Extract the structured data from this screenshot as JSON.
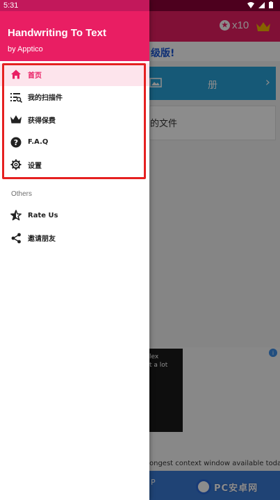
{
  "status_bar": {
    "time": "5:31"
  },
  "drawer": {
    "app_title": "Handwriting To Text",
    "app_subtitle": "by Apptico",
    "menu": [
      {
        "label": "首页",
        "icon": "home-icon",
        "active": true
      },
      {
        "label": "我的扫描件",
        "icon": "scan-list-icon",
        "active": false
      },
      {
        "label": "获得保费",
        "icon": "crown-icon",
        "active": false
      },
      {
        "label": "F.A.Q",
        "icon": "help-circle-icon",
        "active": false
      },
      {
        "label": "设置",
        "icon": "gear-icon",
        "active": false
      }
    ],
    "section_others": "Others",
    "others": [
      {
        "label": "Rate Us",
        "icon": "star-half-icon"
      },
      {
        "label": "邀请朋友",
        "icon": "share-icon"
      }
    ]
  },
  "background": {
    "coins": "x10",
    "upgrade_text": "级版!",
    "banner_text": "册",
    "files_text": "的文件",
    "ad_text_1": "lex",
    "ad_text_2": "t a lot",
    "ad_caption": "ongest context window available today.",
    "bottom_bar_text": "P",
    "watermark_text": "PC安卓网"
  },
  "colors": {
    "primary": "#e91e63",
    "primary_dark": "#c2185b",
    "active_bg": "#fde4ec",
    "highlight_box": "#e52020"
  }
}
